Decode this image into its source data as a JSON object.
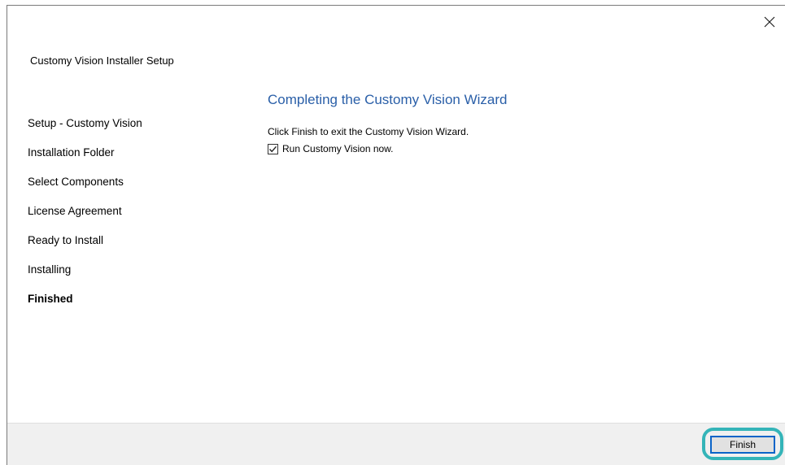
{
  "window": {
    "setup_title": "Customy Vision Installer Setup"
  },
  "sidebar": {
    "items": [
      {
        "label": "Setup - Customy Vision",
        "active": false
      },
      {
        "label": "Installation Folder",
        "active": false
      },
      {
        "label": "Select Components",
        "active": false
      },
      {
        "label": "License Agreement",
        "active": false
      },
      {
        "label": "Ready to Install",
        "active": false
      },
      {
        "label": "Installing",
        "active": false
      },
      {
        "label": "Finished",
        "active": true
      }
    ]
  },
  "main": {
    "heading": "Completing the Customy Vision Wizard",
    "description": "Click Finish to exit the Customy Vision Wizard.",
    "run_checkbox": {
      "label": "Run Customy Vision now.",
      "checked": true
    }
  },
  "footer": {
    "finish_label": "Finish"
  },
  "colors": {
    "heading": "#2a5fa8",
    "highlight": "#34b4b8",
    "button_focus_border": "#0a64c8",
    "footer_bg": "#f0f0f0"
  },
  "icons": {
    "close": "close-icon",
    "check": "checkmark-icon"
  }
}
